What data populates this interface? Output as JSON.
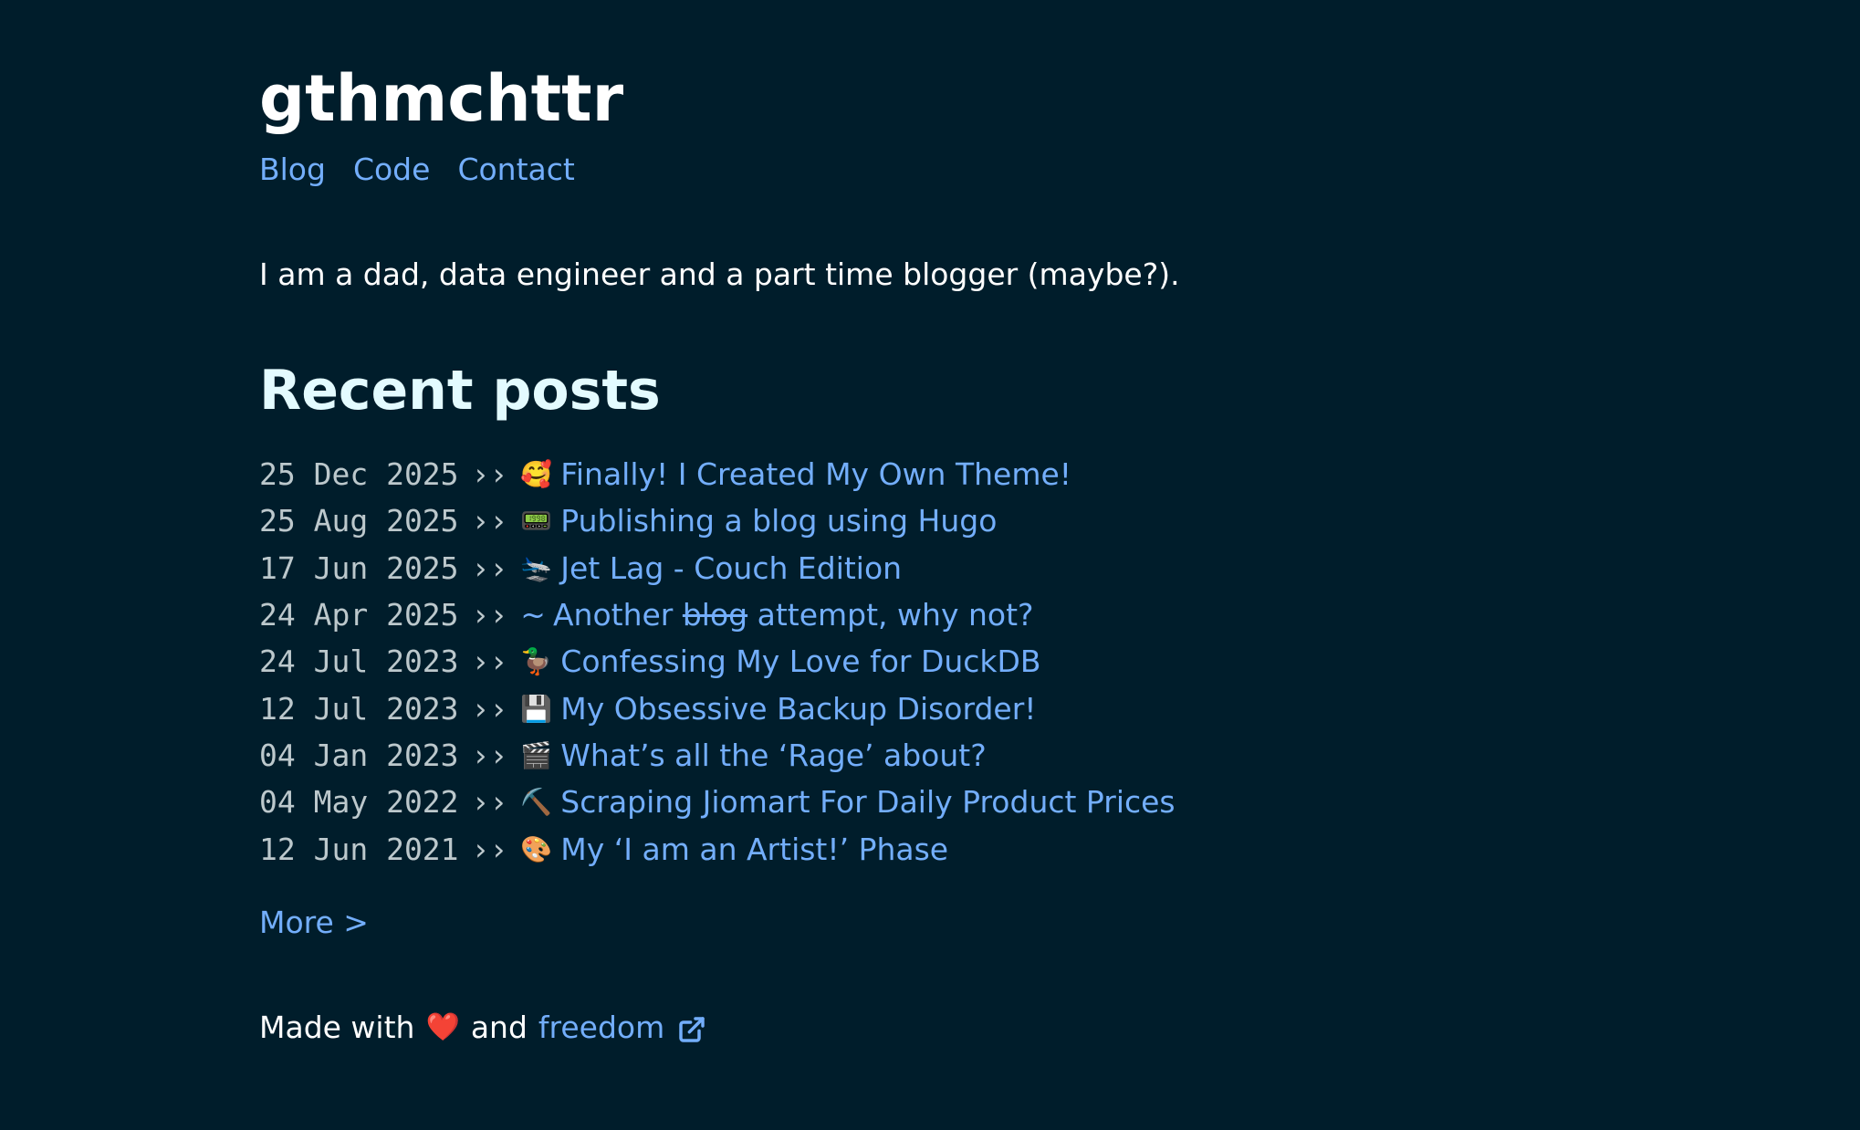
{
  "site": {
    "title": "gthmchttr"
  },
  "nav": [
    {
      "label": "Blog"
    },
    {
      "label": "Code"
    },
    {
      "label": "Contact"
    }
  ],
  "intro": "I am a dad, data engineer and a part time blogger (maybe?).",
  "recent": {
    "heading": "Recent posts",
    "separator": "››",
    "posts": [
      {
        "date": "25 Dec 2025",
        "icon": "🥰",
        "title": "Finally! I Created My Own Theme!"
      },
      {
        "date": "25 Aug 2025",
        "icon": "📟",
        "title": "Publishing a blog using Hugo"
      },
      {
        "date": "17 Jun 2025",
        "icon": "🛬",
        "title": "Jet Lag - Couch Edition"
      },
      {
        "date": "24 Apr 2025",
        "icon": "~",
        "title_before": "Another",
        "title_struck": "blog",
        "title_after": "attempt, why not?"
      },
      {
        "date": "24 Jul 2023",
        "icon": "🦆",
        "title": "Confessing My Love for DuckDB"
      },
      {
        "date": "12 Jul 2023",
        "icon": "💾",
        "title": "My Obsessive Backup Disorder!"
      },
      {
        "date": "04 Jan 2023",
        "icon": "🎬",
        "title": "What’s all the ‘Rage’ about?"
      },
      {
        "date": "04 May 2022",
        "icon": "⛏️",
        "title": "Scraping Jiomart For Daily Product Prices"
      },
      {
        "date": "12 Jun 2021",
        "icon": "🎨",
        "title": "My ‘I am an Artist!’ Phase"
      }
    ]
  },
  "more": {
    "label": "More >"
  },
  "footer": {
    "made_with": "Made with",
    "heart": "❤️",
    "and": "and",
    "link": "freedom",
    "link_icon": "external-link-icon"
  },
  "colors": {
    "background": "#001d2b",
    "link": "#73aefb",
    "heading": "#e3fbff",
    "date": "#bcc8cc"
  }
}
